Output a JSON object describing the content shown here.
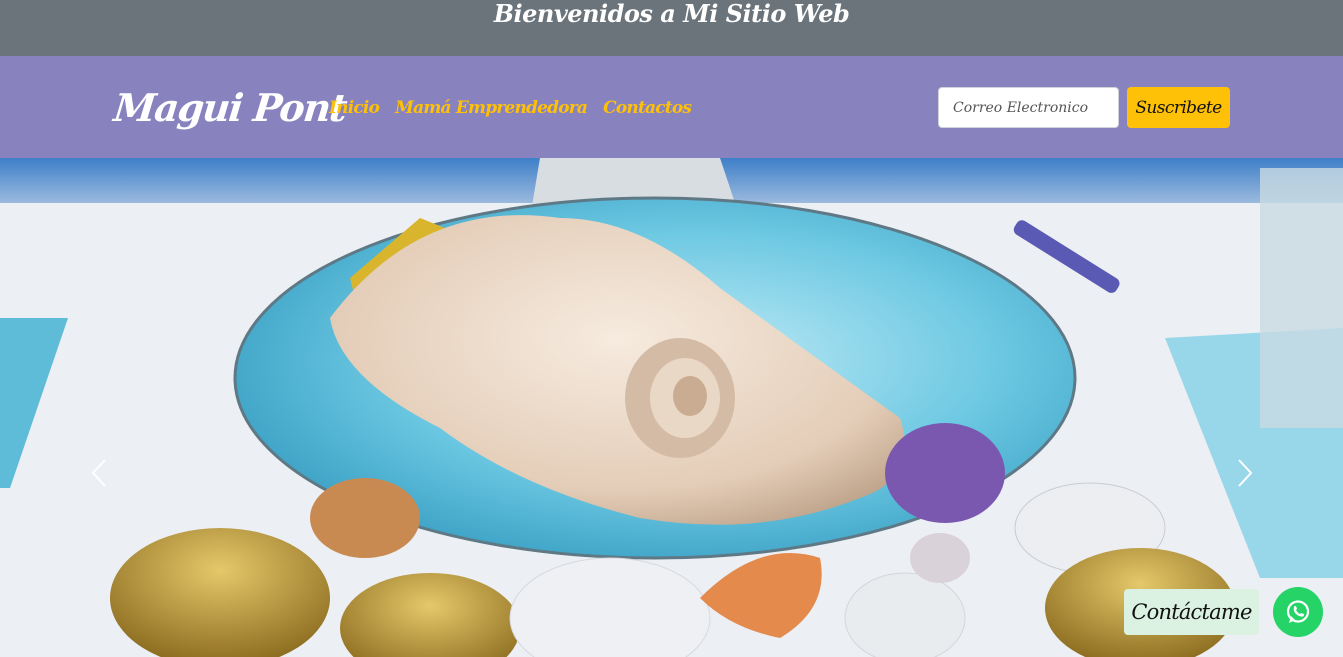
{
  "header": {
    "welcome_text": "Bienvenidos a Mi Sitio Web"
  },
  "navbar": {
    "brand": "Magui Pont",
    "links": [
      {
        "label": "Inicio"
      },
      {
        "label": "Mamá Emprendedora"
      },
      {
        "label": "Contactos"
      }
    ],
    "email_placeholder": "Correo Electronico",
    "email_value": "",
    "subscribe_label": "Suscribete"
  },
  "carousel": {
    "prev_icon": "chevron-left-icon",
    "next_icon": "chevron-right-icon"
  },
  "contact": {
    "label": "Contáctame",
    "icon": "whatsapp-icon"
  },
  "colors": {
    "welcome_bar": "#6b737b",
    "navbar": "#8882bf",
    "accent": "#ffc107",
    "whatsapp": "#25d366",
    "contact_badge": "#dbf1e1"
  }
}
